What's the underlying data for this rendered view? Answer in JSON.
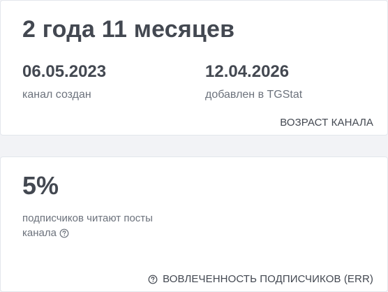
{
  "age_card": {
    "age_text": "2 года 11 месяцев",
    "created_date": "06.05.2023",
    "created_label": "канал создан",
    "added_date": "12.04.2026",
    "added_label": "добавлен в TGStat",
    "footer_label": "ВОЗРАСТ КАНАЛА"
  },
  "err_card": {
    "value": "5%",
    "description": "подписчиков читают посты канала",
    "footer_label": "ВОВЛЕЧЕННОСТЬ ПОДПИСЧИКОВ (ERR)",
    "help_icon": "question-circle-icon"
  },
  "colors": {
    "background": "#f2f3f6",
    "card": "#ffffff",
    "heading": "#434851",
    "muted": "#6c727c",
    "border": "#e3e6ec"
  }
}
